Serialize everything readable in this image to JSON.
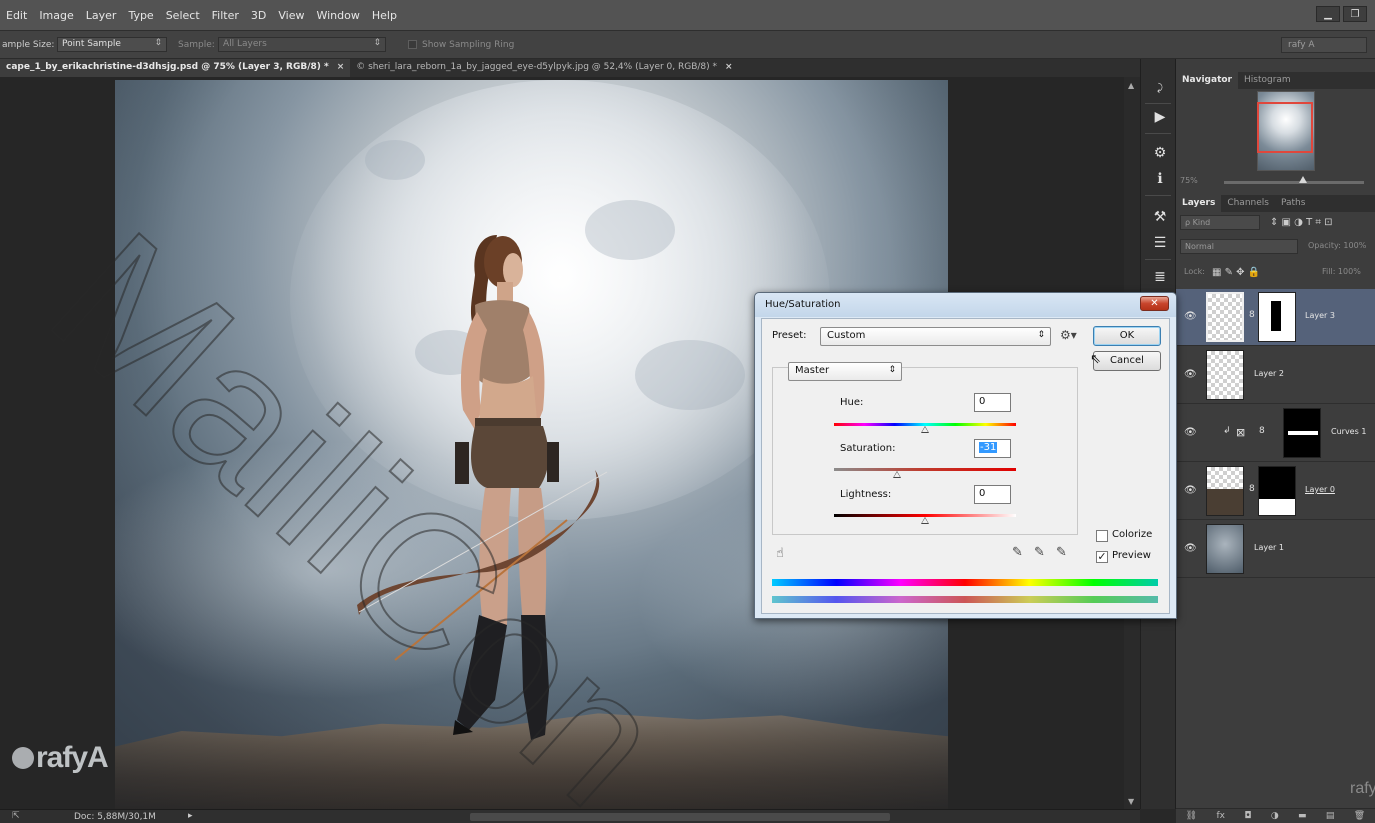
{
  "menu": {
    "items": [
      "Edit",
      "Image",
      "Layer",
      "Type",
      "Select",
      "Filter",
      "3D",
      "View",
      "Window",
      "Help"
    ]
  },
  "options": {
    "sample_size_label": "ample Size:",
    "sample_size_value": "Point Sample",
    "sample_label": "Sample:",
    "sample_value": "All Layers",
    "show_sampling_ring": "Show Sampling Ring",
    "workspace": "rafy A"
  },
  "tabs": [
    {
      "label": "cape_1_by_erikachristine-d3dhsjg.psd @ 75% (Layer 3, RGB/8) *",
      "close": "×"
    },
    {
      "label": "© sheri_lara_reborn_1a_by_jagged_eye-d5ylpyk.jpg @ 52,4% (Layer 0, RGB/8) *",
      "close": "×"
    }
  ],
  "status": {
    "doc": "Doc: 5,88M/30,1M"
  },
  "watermark": {
    "logo": "rafyA",
    "small": "rafyA",
    "diagonal": "MailiCon"
  },
  "panels": {
    "navigator_tab": "Navigator",
    "histogram_tab": "Histogram",
    "zoom": "75%",
    "layers_tab": "Layers",
    "channels_tab": "Channels",
    "paths_tab": "Paths",
    "filter_kind": "ρ Kind",
    "blend_mode": "Normal",
    "opacity_label": "Opacity: 100%",
    "lock_label": "Lock:",
    "fill_label": "Fill: 100%",
    "layers": [
      {
        "name": "Layer 3"
      },
      {
        "name": "Layer 2"
      },
      {
        "name": "Curves 1"
      },
      {
        "name": "Layer 0"
      },
      {
        "name": "Layer 1"
      }
    ]
  },
  "dialog": {
    "title": "Hue/Saturation",
    "close": "✕",
    "preset_label": "Preset:",
    "preset_value": "Custom",
    "ok": "OK",
    "cancel": "Cancel",
    "channel": "Master",
    "hue_label": "Hue:",
    "hue_value": "0",
    "saturation_label": "Saturation:",
    "saturation_value": "-31",
    "lightness_label": "Lightness:",
    "lightness_value": "0",
    "colorize_label": "Colorize",
    "colorize_checked": false,
    "preview_label": "Preview",
    "preview_checked": true,
    "hue_fraction": 0.5,
    "saturation_fraction": 0.345,
    "lightness_fraction": 0.5
  }
}
